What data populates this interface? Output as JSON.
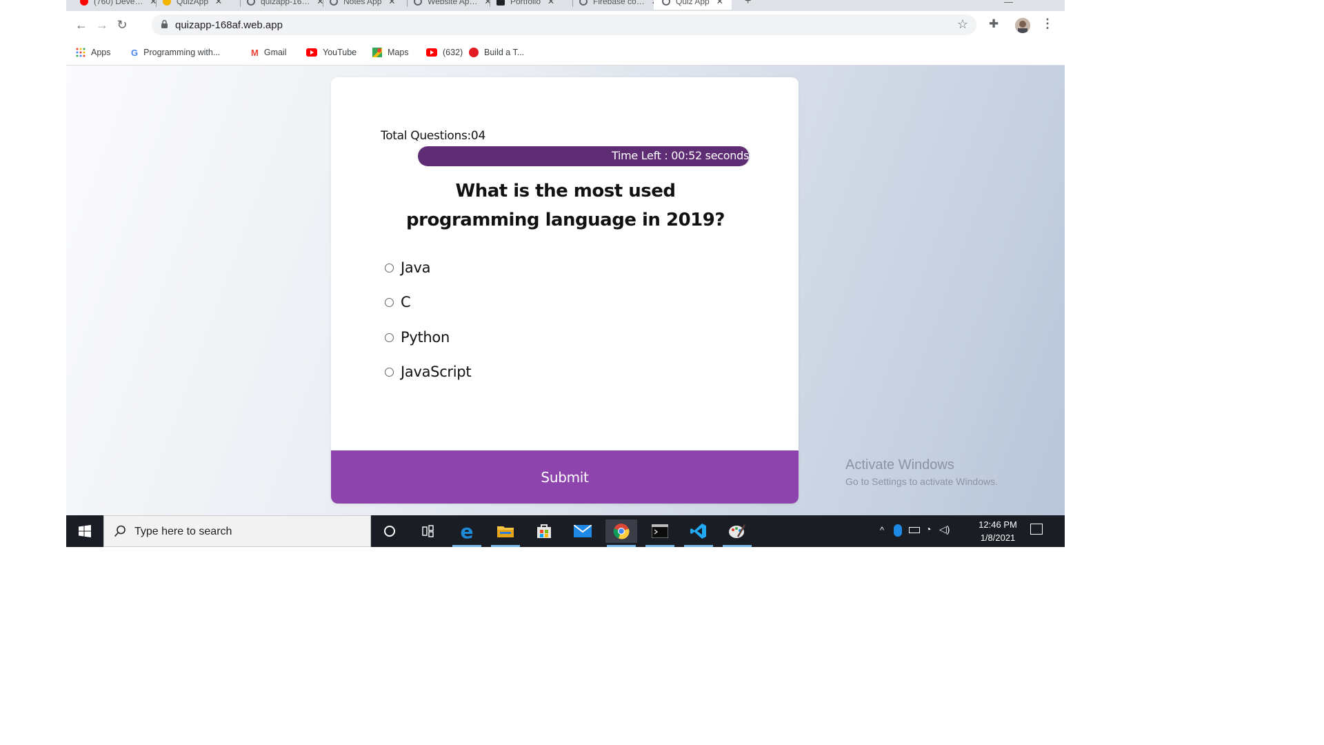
{
  "browser": {
    "tabs": [
      {
        "title": "(760) Deve…",
        "color": "#ff0000"
      },
      {
        "title": "QuizApp",
        "color": "#f5b400"
      },
      {
        "title": "quizapp-16…",
        "color": "#5f6368"
      },
      {
        "title": "Notes App",
        "color": "#5f6368"
      },
      {
        "title": "Website Ap…",
        "color": "#5f6368"
      },
      {
        "title": "Portfolio",
        "color": "#202124"
      },
      {
        "title": "Firebase co…",
        "color": "#5f6368"
      },
      {
        "title": "Quiz App",
        "color": "#5f6368"
      }
    ],
    "url": "quizapp-168af.web.app",
    "bookmarks": [
      {
        "label": "Apps",
        "icon": "apps-grid-icon"
      },
      {
        "label": "Programming with...",
        "icon": "google-icon"
      },
      {
        "label": "Gmail",
        "icon": "gmail-icon"
      },
      {
        "label": "YouTube",
        "icon": "youtube-icon"
      },
      {
        "label": "Maps",
        "icon": "maps-icon"
      },
      {
        "label": "(632)",
        "icon": "youtube-icon"
      },
      {
        "label": "Build a T...",
        "icon": "record-icon"
      }
    ]
  },
  "quiz": {
    "total_questions": "Total Questions:04",
    "timer_text": "Time Left : 00:52 seconds",
    "timer_fraction": 0.995,
    "question": "What is the most used programming language in 2019?",
    "options": [
      "Java",
      "C",
      "Python",
      "JavaScript"
    ],
    "submit_label": "Submit"
  },
  "watermark": {
    "title": "Activate Windows",
    "subtitle": "Go to Settings to activate Windows."
  },
  "taskbar": {
    "search_placeholder": "Type here to search",
    "time": "12:46 PM",
    "date": "1/8/2021"
  },
  "colors": {
    "timer_fill": "#5e2d74",
    "submit_bg": "#8e44ad",
    "taskbar_bg": "#1b1d25"
  }
}
